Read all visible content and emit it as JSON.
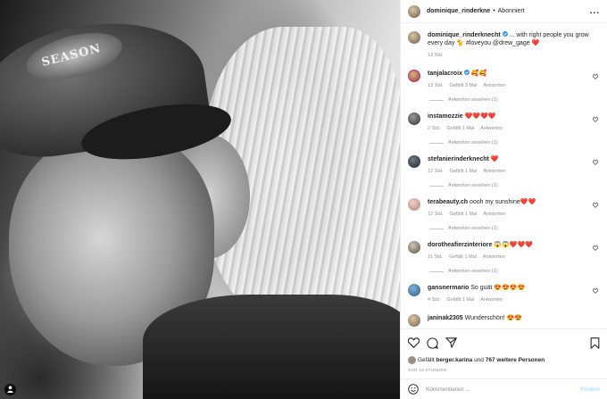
{
  "header": {
    "username": "dominique_rinderkne",
    "separator": "•",
    "follow_state": "Abonniert",
    "more": "..."
  },
  "caption": {
    "username": "dominique_rinderknecht",
    "text": "... with right people you grow every day 🐈 #loveyou @drew_gage ❤️",
    "time": "13 Std."
  },
  "comments": [
    {
      "username": "tanjalacroix",
      "text": "🥰🥰",
      "time": "13 Std.",
      "likes": "Gefällt 3 Mal",
      "reply": "Antworten",
      "replies": "Antworten ansehen (1)"
    },
    {
      "username": "instamozzie",
      "text": "❤️❤️❤️❤️",
      "time": "2 Std.",
      "likes": "Gefällt 1 Mal",
      "reply": "Antworten",
      "replies": "Antworten ansehen (1)"
    },
    {
      "username": "stefanierinderknecht",
      "text": "❤️",
      "time": "12 Std.",
      "likes": "Gefällt 1 Mal",
      "reply": "Antworten",
      "replies": "Antworten ansehen (1)"
    },
    {
      "username": "terabeauty.ch",
      "text": "oooh my sunshine❤️❤️",
      "time": "12 Std.",
      "likes": "Gefällt 1 Mal",
      "reply": "Antworten",
      "replies": "Antworten ansehen (1)"
    },
    {
      "username": "dorotheafierzinteriore",
      "text": "😱😱❤️❤️❤️",
      "time": "11 Std.",
      "likes": "Gefällt 1 Mal",
      "reply": "Antworten",
      "replies": "Antworten ansehen (1)"
    },
    {
      "username": "gansnermario",
      "text": "So guät 😍😍😍😍",
      "time": "4 Std.",
      "likes": "Gefällt 1 Mal",
      "reply": "Antworten"
    },
    {
      "username": "janinak2305",
      "text": "Wunderschön! 😍😍"
    }
  ],
  "actions": {
    "liked_prefix": "Gefällt",
    "liked_by": "berger.karina",
    "liked_mid": "und",
    "liked_others": "767 weitere Personen",
    "time_ago": "VOR 13 STUNDEN"
  },
  "add_comment": {
    "placeholder": "Kommentieren ...",
    "post_label": "Posten"
  },
  "photo": {
    "cap_text": "SEASON"
  },
  "colors": {
    "heart": "#ed4956",
    "verified": "#3897f0",
    "post_disabled": "#b2dffc"
  }
}
